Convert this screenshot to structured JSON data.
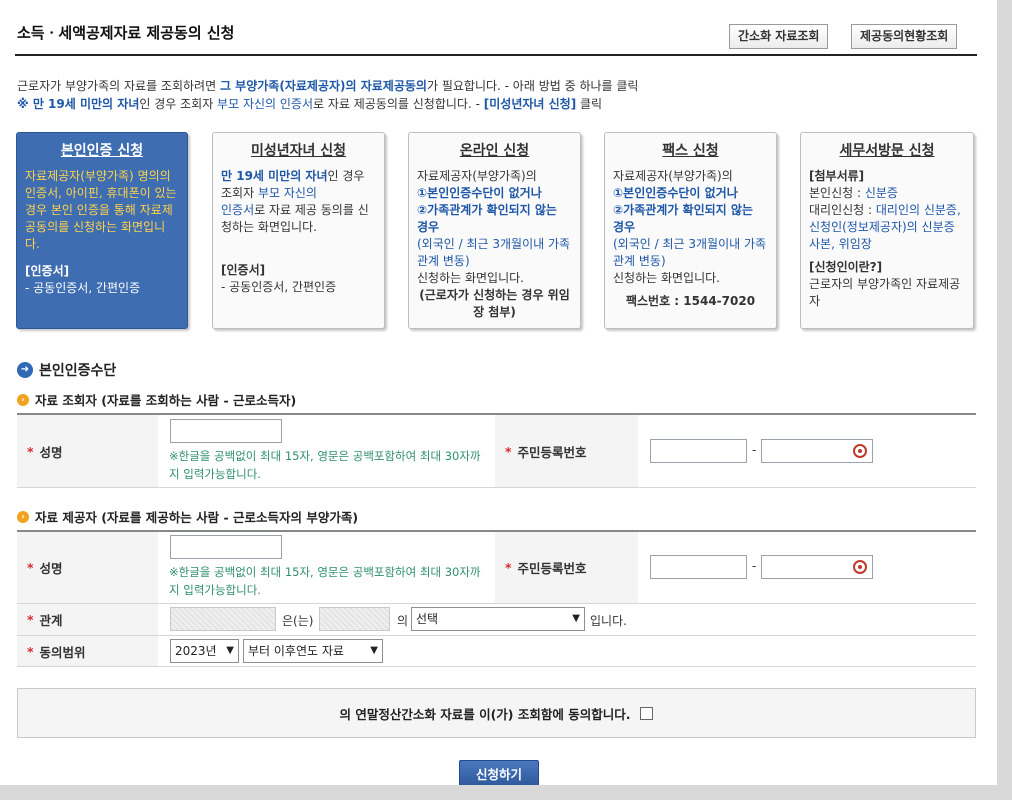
{
  "page": {
    "title": "소득ㆍ세액공제자료 제공동의 신청",
    "buttons": {
      "simple_lookup": "간소화 자료조회",
      "consent_status": "제공동의현황조회"
    }
  },
  "intro": {
    "line1_a": "근로자가 부양가족의 자료를 조회하려면 ",
    "line1_b": "그 부양가족(자료제공자)의 자료제공동의",
    "line1_c": "가 필요합니다. - 아래 방법 중 하나를 클릭",
    "line2_a": "※ 만 19세 미만의 자녀",
    "line2_b": "인 경우 조회자 ",
    "line2_c": "부모 자신의 인증서",
    "line2_d": "로 자료 제공동의를 신청합니다. - ",
    "line2_e": "[미성년자녀 신청]",
    "line2_f": " 클릭"
  },
  "cards": {
    "self": {
      "title": "본인인증 신청",
      "body": "자료제공자(부양가족) 명의의 인증서, 아이핀, 휴대폰이 있는 경우 본인 인증을 통해 자료제공동의를 신청하는 화면입니다.",
      "cert_label": "[인증서]",
      "cert_list": "- 공동인증서, 간편인증"
    },
    "minor": {
      "title": "미성년자녀 신청",
      "b1": "만 19세 미만의 자녀",
      "b2": "인 경우 조회자 ",
      "b3": "부모 자신의",
      "b4": "인증서",
      "b5": "로 자료 제공 동의를 신청하는 화면입니다.",
      "cert_label": "[인증서]",
      "cert_list": "- 공동인증서, 간편인증"
    },
    "online": {
      "title": "온라인 신청",
      "l1": "자료제공자(부양가족)의",
      "l2": "①본인인증수단이 없거나",
      "l3": "②가족관계가 확인되지 않는 경우",
      "l4": "(외국인 / 최근 3개월이내 가족관계 변동)",
      "l5": "신청하는 화면입니다.",
      "l6": "(근로자가 신청하는 경우 위임장 첨부)"
    },
    "fax": {
      "title": "팩스 신청",
      "l1": "자료제공자(부양가족)의",
      "l2": "①본인인증수단이 없거나",
      "l3": "②가족관계가 확인되지 않는 경우",
      "l4": "(외국인 / 최근 3개월이내 가족관계 변동)",
      "l5": "신청하는 화면입니다.",
      "fax_no": "팩스번호 : 1544-7020"
    },
    "visit": {
      "title": "세무서방문 신청",
      "docs_label": "[첨부서류]",
      "self_apply": "본인신청 : ",
      "self_doc": "신분증",
      "proxy_apply": "대리인신청 : ",
      "proxy_doc": "대리인의 신분증, 신청인(정보제공자)의 신분증 사본, 위임장",
      "who_label": "[신청인이란?]",
      "who_text": "근로자의 부양가족인 자료제공자"
    }
  },
  "section": {
    "title": "본인인증수단",
    "viewer_title": "자료 조회자 (자료를 조회하는 사람 - 근로소득자)",
    "provider_title": "자료 제공자 (자료를 제공하는 사람 - 근로소득자의 부양가족)"
  },
  "form": {
    "name_label": "성명",
    "rrn_label": "주민등록번호",
    "name_note": "※한글을 공백없이 최대 15자, 영문은 공백포함하여 최대 30자까지 입력가능합니다.",
    "rrn_dash": "-",
    "relation_label": "관계",
    "relation_eun": "은(는)",
    "relation_ui": "의",
    "relation_select": "선택",
    "relation_end": "입니다.",
    "scope_label": "동의범위",
    "year_select": "2023년",
    "scope_select": "부터 이후연도 자료"
  },
  "agree": {
    "text": "의 연말정산간소화 자료를 이(가) 조회함에 동의합니다."
  },
  "submit": "신청하기"
}
